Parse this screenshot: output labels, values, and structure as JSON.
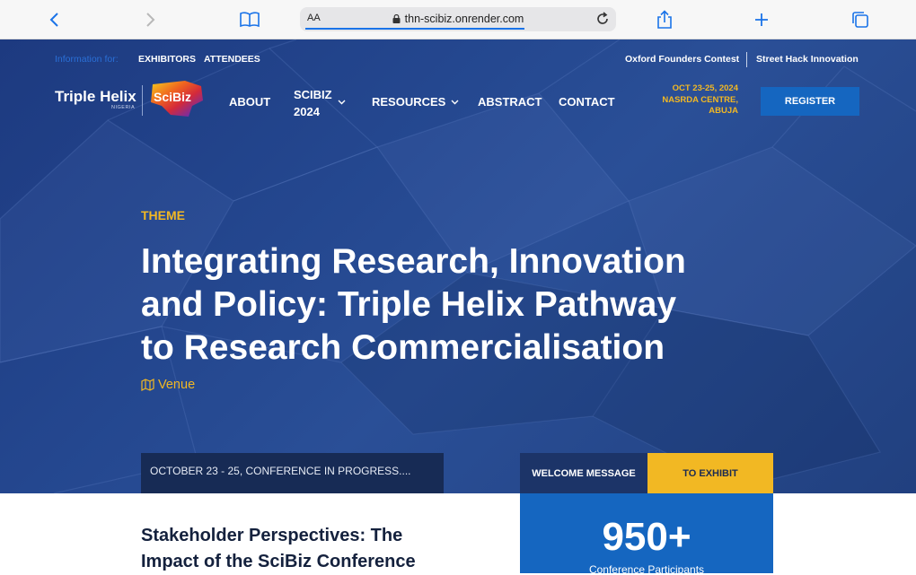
{
  "browser": {
    "url": "thn-scibiz.onrender.com",
    "reader_label": "AA"
  },
  "topbar": {
    "info_label": "Information for:",
    "links": [
      "EXHIBITORS",
      "ATTENDEES"
    ],
    "right_links": [
      "Oxford Founders Contest",
      "Street Hack Innovation"
    ]
  },
  "logo": {
    "name": "Triple Helix",
    "sub": "NIGERIA",
    "badge": "SciBiz"
  },
  "nav": {
    "about": "ABOUT",
    "scibiz_line1": "SCIBIZ",
    "scibiz_line2": "2024",
    "resources": "RESOURCES",
    "abstract": "ABSTRACT",
    "contact": "CONTACT"
  },
  "event": {
    "date": "OCT 23-25, 2024",
    "venue_line1": "NASRDA CENTRE,",
    "venue_line2": "ABUJA",
    "register": "REGISTER"
  },
  "hero": {
    "theme_label": "THEME",
    "headline_line1": "Integrating Research, Innovation",
    "headline_line2": "and Policy: Triple Helix Pathway",
    "headline_line3": "to Research Commercialisation",
    "venue_link": "Venue",
    "ticker": "OCTOBER 23 - 25, CONFERENCE IN PROGRESS....",
    "tab_welcome": "WELCOME MESSAGE",
    "tab_exhibit": "TO EXHIBIT"
  },
  "section": {
    "title_line1": "Stakeholder Perspectives: The",
    "title_line2": "Impact of the SciBiz Conference"
  },
  "stats": {
    "number": "950+",
    "label": "Conference Participants"
  },
  "colors": {
    "accent_yellow": "#f2b823",
    "brand_blue": "#1566c0",
    "hero_navy": "#1d3a80",
    "ticker_bg": "#172b55"
  }
}
